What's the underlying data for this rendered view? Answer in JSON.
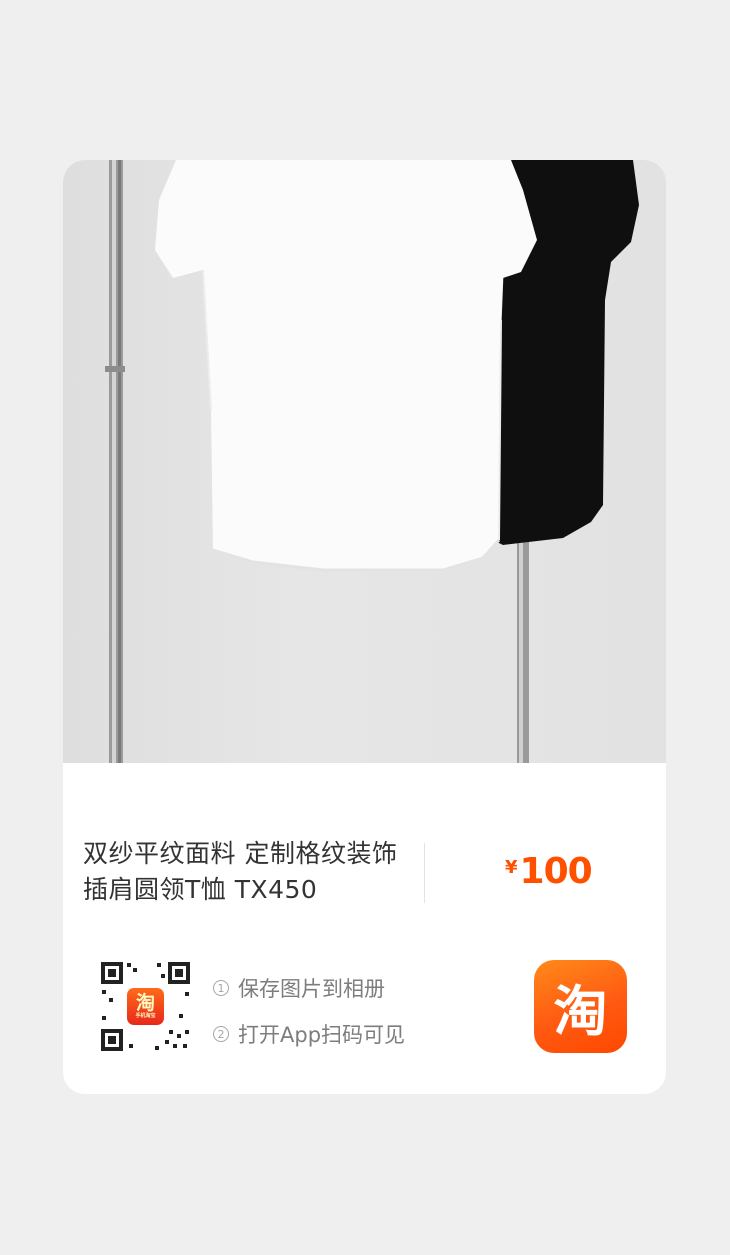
{
  "product": {
    "title": "双纱平纹面料 定制格纹装饰 插肩圆领T恤 TX450",
    "currency_symbol": "¥",
    "price": "100"
  },
  "qr": {
    "badge_char": "淘",
    "badge_caption": "手机淘宝"
  },
  "steps": [
    {
      "number": "1",
      "text": "保存图片到相册"
    },
    {
      "number": "2",
      "text": "打开App扫码可见"
    }
  ],
  "app_icon": {
    "char": "淘",
    "color": "#ff5000"
  },
  "colors": {
    "price": "#ff5000",
    "background": "#efefef",
    "card": "#ffffff"
  }
}
